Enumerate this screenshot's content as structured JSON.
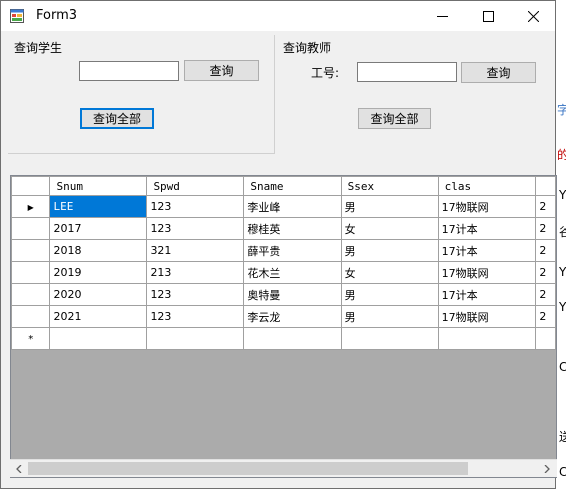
{
  "window": {
    "title": "Form3"
  },
  "student_group": {
    "label": "查询学生",
    "search_value": "",
    "search_button": "查询",
    "all_button": "查询全部"
  },
  "teacher_group": {
    "label": "查询教师",
    "id_label": "工号:",
    "search_value": "",
    "search_button": "查询",
    "all_button": "查询全部"
  },
  "grid": {
    "columns": [
      "Snum",
      "Spwd",
      "Sname",
      "Ssex",
      "clas"
    ],
    "rows": [
      [
        "LEE",
        "123",
        "李业峰",
        "男",
        "17物联网"
      ],
      [
        "2017",
        "123",
        "穆桂英",
        "女",
        "17计本"
      ],
      [
        "2018",
        "321",
        "薛平贵",
        "男",
        "17计本"
      ],
      [
        "2019",
        "213",
        "花木兰",
        "女",
        "17物联网"
      ],
      [
        "2020",
        "123",
        "奥特曼",
        "男",
        "17计本"
      ],
      [
        "2021",
        "123",
        "李云龙",
        "男",
        "17物联网"
      ]
    ],
    "overflow_cells": [
      "2",
      "2",
      "2",
      "2",
      "2",
      "2"
    ],
    "current_row_marker": "▶",
    "new_row_marker": "*",
    "selected_color": "#0078d7"
  },
  "background": {
    "glyphs": [
      "字",
      "的",
      "Y",
      "谷",
      "Y",
      "Y",
      "C",
      "送",
      "C"
    ]
  }
}
